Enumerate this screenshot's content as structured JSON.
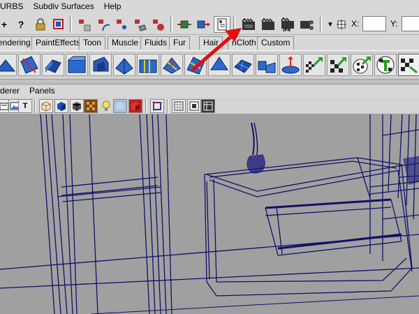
{
  "menubar": {
    "items": [
      "URBS",
      "Subdiv Surfaces",
      "Help"
    ]
  },
  "statusline": {
    "coord_x_label": "X:",
    "coord_y_label": "Y:",
    "coord_x_value": "",
    "coord_y_value": ""
  },
  "shelf_tabs": [
    "endering",
    "PaintEffects",
    "Toon",
    "Muscle",
    "Fluids",
    "Fur",
    "Hair",
    "nCloth",
    "Custom"
  ],
  "panel_menus": [
    "derer",
    "Panels"
  ],
  "annotation": {
    "arrow_color": "#e01010"
  },
  "colors": {
    "viewport_bg": "#a0a0a0",
    "wireframe": "#101070"
  }
}
